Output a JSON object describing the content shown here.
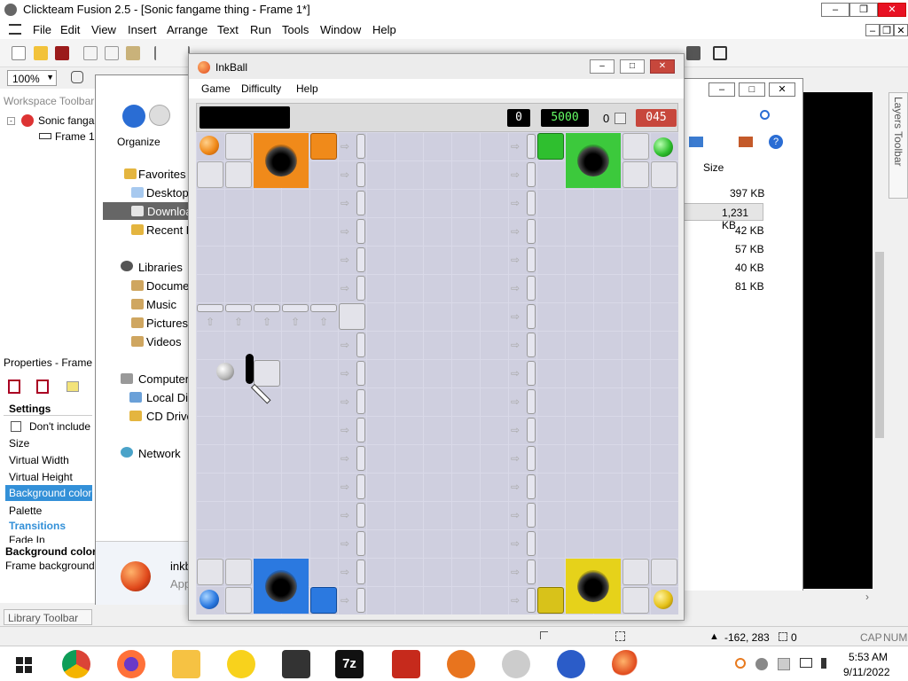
{
  "app": {
    "title": "Clickteam Fusion 2.5 - [Sonic fangame thing - Frame 1*]",
    "menu": [
      "File",
      "Edit",
      "View",
      "Insert",
      "Arrange",
      "Text",
      "Run",
      "Tools",
      "Window",
      "Help"
    ],
    "zoom": "100%"
  },
  "workspace": {
    "header": "Workspace Toolbar",
    "tree_root": "Sonic fanga",
    "tree_child": "Frame 1"
  },
  "properties": {
    "header": "Properties - Frame 1",
    "settings": "Settings",
    "dont_include": "Don't include",
    "rows": [
      "Size",
      "Virtual Width",
      "Virtual Height",
      "Background color",
      "Palette"
    ],
    "transitions": "Transitions",
    "fade_in": "Fade In",
    "desc_title": "Background color",
    "desc_text": "Frame background"
  },
  "library": {
    "label": "Library Toolbar"
  },
  "layers": {
    "label": "Layers Toolbar"
  },
  "explorer": {
    "organize": "Organize",
    "items": [
      "Favorites",
      "Desktop",
      "Downloa",
      "Recent P",
      "Libraries",
      "Documer",
      "Music",
      "Pictures",
      "Videos",
      "Computer",
      "Local Dis",
      "CD Drive",
      "Network"
    ],
    "footer_name": "inkb",
    "footer_type": "App"
  },
  "explorer2": {
    "size_header": "Size",
    "sizes": [
      "397 KB",
      "1,231 KB",
      "42 KB",
      "57 KB",
      "40 KB",
      "81 KB"
    ]
  },
  "inkball": {
    "title": "InkBall",
    "menu": [
      "Game",
      "Difficulty",
      "Help"
    ],
    "score": "0",
    "target": "5000",
    "ink": "0",
    "timer": "045"
  },
  "status": {
    "coords": "-162, 283",
    "count": "0",
    "caps": "CAP",
    "num": "NUM"
  },
  "taskbar": {
    "time": "5:53 AM",
    "date": "9/11/2022"
  }
}
